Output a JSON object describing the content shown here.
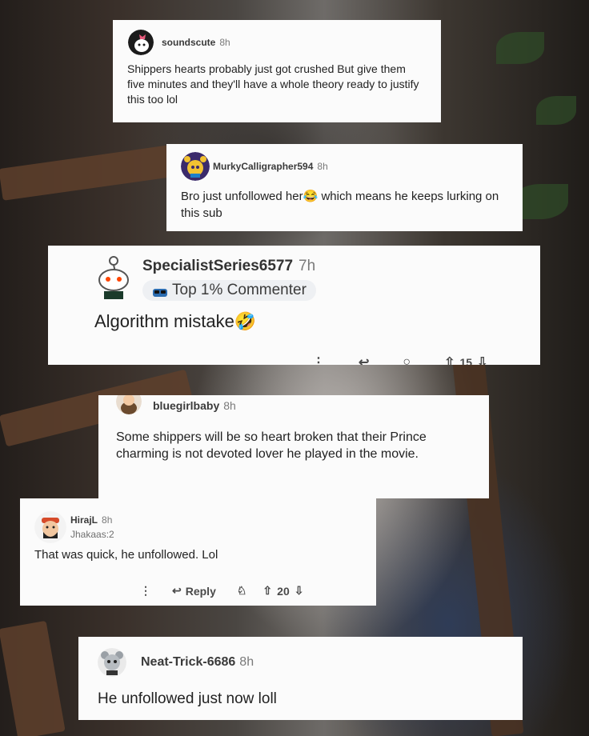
{
  "comments": [
    {
      "username": "soundscute",
      "age": "8h",
      "text": "Shippers hearts probably just got crushed But give them five minutes and they'll have a whole theory ready to justify this too lol"
    },
    {
      "username": "MurkyCalligrapher594",
      "age": "8h",
      "text_before": "Bro just unfollowed her",
      "emoji": "😂",
      "text_after": " which means he keeps lurking on this sub"
    },
    {
      "username": "SpecialistSeries6577",
      "age": "7h",
      "badge": "Top 1% Commenter",
      "text": "Algorithm mistake",
      "emoji": "🤣",
      "vote_partial": "15"
    },
    {
      "username": "bluegirlbaby",
      "age": "8h",
      "text": "Some shippers will be so heart broken that their Prince charming is not devoted lover he played in the movie."
    },
    {
      "username": "HirajL",
      "age": "8h",
      "flair": "Jhakaas:2",
      "text": "That was quick, he unfollowed. Lol",
      "reply_label": "Reply",
      "votes": "20"
    },
    {
      "username": "Neat-Trick-6686",
      "age": "8h",
      "text": "He unfollowed just now loll"
    }
  ],
  "icons": [
    "more-icon",
    "reply-arrow-icon",
    "award-icon",
    "upvote-icon",
    "downvote-icon"
  ],
  "colors": {
    "card_bg": "#fbfbfb",
    "text": "#1c1c1c",
    "muted": "#7a7a7a",
    "badge_bg": "#eef0f3"
  }
}
